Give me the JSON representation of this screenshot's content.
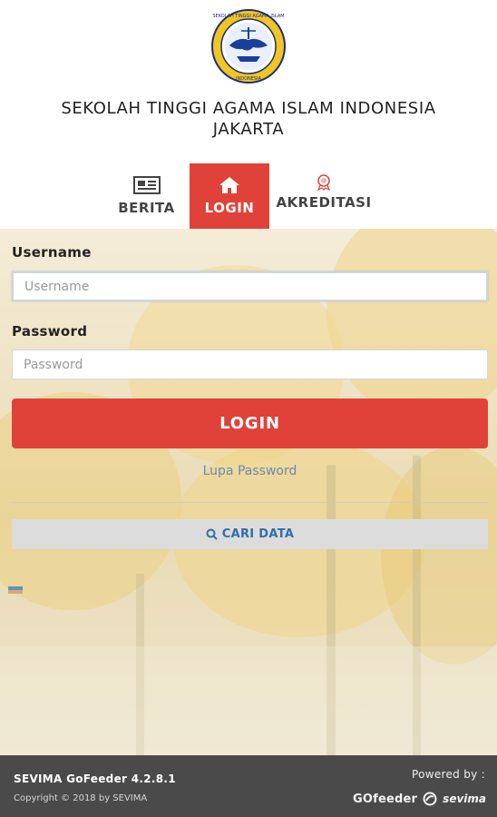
{
  "header": {
    "college_name_line1": "SEKOLAH TINGGI AGAMA ISLAM INDONESIA",
    "college_name_line2": "JAKARTA",
    "logo_text_top": "SEKOLAH TINGGI AGAMA ISLAM",
    "logo_text_bottom": "INDONESIA"
  },
  "tabs": [
    {
      "label": "BERITA",
      "icon": "newspaper-icon",
      "active": false
    },
    {
      "label": "LOGIN",
      "icon": "home-icon",
      "active": true
    },
    {
      "label": "AKREDITASI",
      "icon": "certificate-icon",
      "active": false
    }
  ],
  "form": {
    "username_label": "Username",
    "username_placeholder": "Username",
    "password_label": "Password",
    "password_placeholder": "Password",
    "login_button": "LOGIN",
    "forgot_link": "Lupa Password",
    "search_button": "CARI DATA"
  },
  "footer": {
    "version": "SEVIMA GoFeeder 4.2.8.1",
    "copyright": "Copyright © 2018 by SEVIMA",
    "powered_by": "Powered by :",
    "brand_gofeeder": "GOfeeder",
    "brand_sevima": "sevima"
  },
  "colors": {
    "accent": "#e0423a",
    "link": "#6b8aaa",
    "search_text": "#2f6fa8",
    "footer_bg": "#4a4a4a"
  }
}
